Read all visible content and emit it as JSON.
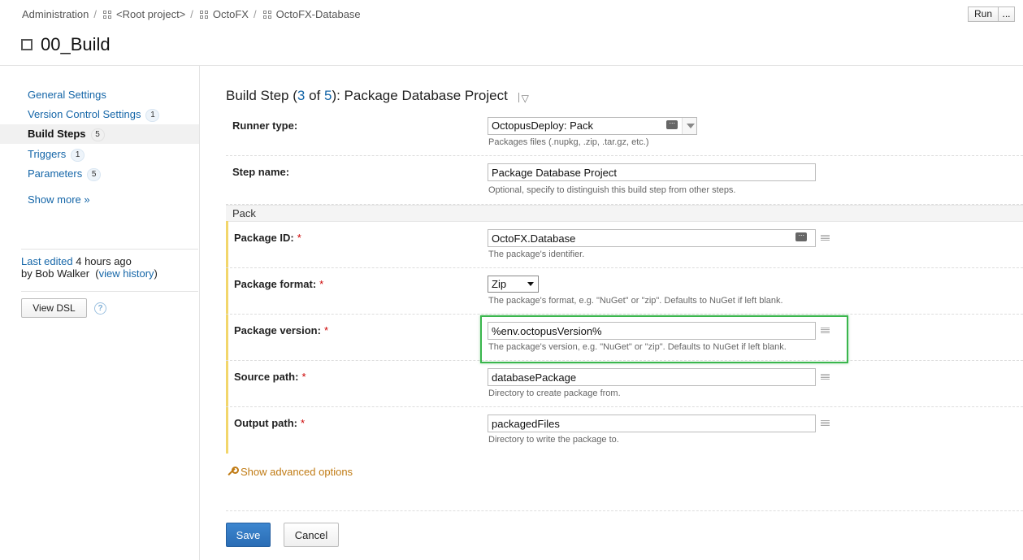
{
  "breadcrumb": {
    "admin": "Administration",
    "root": "<Root project>",
    "project": "OctoFX",
    "subproject": "OctoFX-Database",
    "separator": "/"
  },
  "header": {
    "title": "00_Build",
    "run_label": "Run",
    "run_more_label": "..."
  },
  "sidebar": {
    "items": [
      {
        "label": "General Settings",
        "badge": ""
      },
      {
        "label": "Version Control Settings",
        "badge": "1"
      },
      {
        "label": "Build Steps",
        "badge": "5"
      },
      {
        "label": "Triggers",
        "badge": "1"
      },
      {
        "label": "Parameters",
        "badge": "5"
      }
    ],
    "show_more": "Show more »",
    "last_edited_link": "Last edited",
    "last_edited_time": " 4 hours ago",
    "by_text": "by Bob Walker",
    "view_history": "view history",
    "view_dsl": "View DSL",
    "help_glyph": "?"
  },
  "step": {
    "prefix": "Build Step (",
    "current": "3",
    "of": " of ",
    "total": "5",
    "suffix": "): Package Database Project"
  },
  "form": {
    "runner_type": {
      "label": "Runner type:",
      "value": "OctopusDeploy: Pack",
      "hint": "Packages files (.nupkg, .zip, .tar.gz, etc.)"
    },
    "step_name": {
      "label": "Step name:",
      "value": "Package Database Project",
      "hint": "Optional, specify to distinguish this build step from other steps."
    },
    "section": "Pack",
    "package_id": {
      "label": "Package ID:",
      "value": "OctoFX.Database",
      "hint": "The package's identifier."
    },
    "package_format": {
      "label": "Package format:",
      "value": "Zip",
      "hint": "The package's format, e.g. \"NuGet\" or \"zip\". Defaults to NuGet if left blank."
    },
    "package_version": {
      "label": "Package version:",
      "value": "%env.octopusVersion%",
      "hint": "The package's version, e.g. \"NuGet\" or \"zip\". Defaults to NuGet if left blank."
    },
    "source_path": {
      "label": "Source path:",
      "value": "databasePackage",
      "hint": "Directory to create package from."
    },
    "output_path": {
      "label": "Output path:",
      "value": "packagedFiles",
      "hint": "Directory to write the package to."
    },
    "required_mark": "*",
    "show_advanced": "Show advanced options"
  },
  "actions": {
    "save": "Save",
    "cancel": "Cancel"
  },
  "colors": {
    "link": "#1566a8",
    "highlight": "#3ab64d",
    "advanced": "#c07b14",
    "save": "#2a6db5"
  }
}
